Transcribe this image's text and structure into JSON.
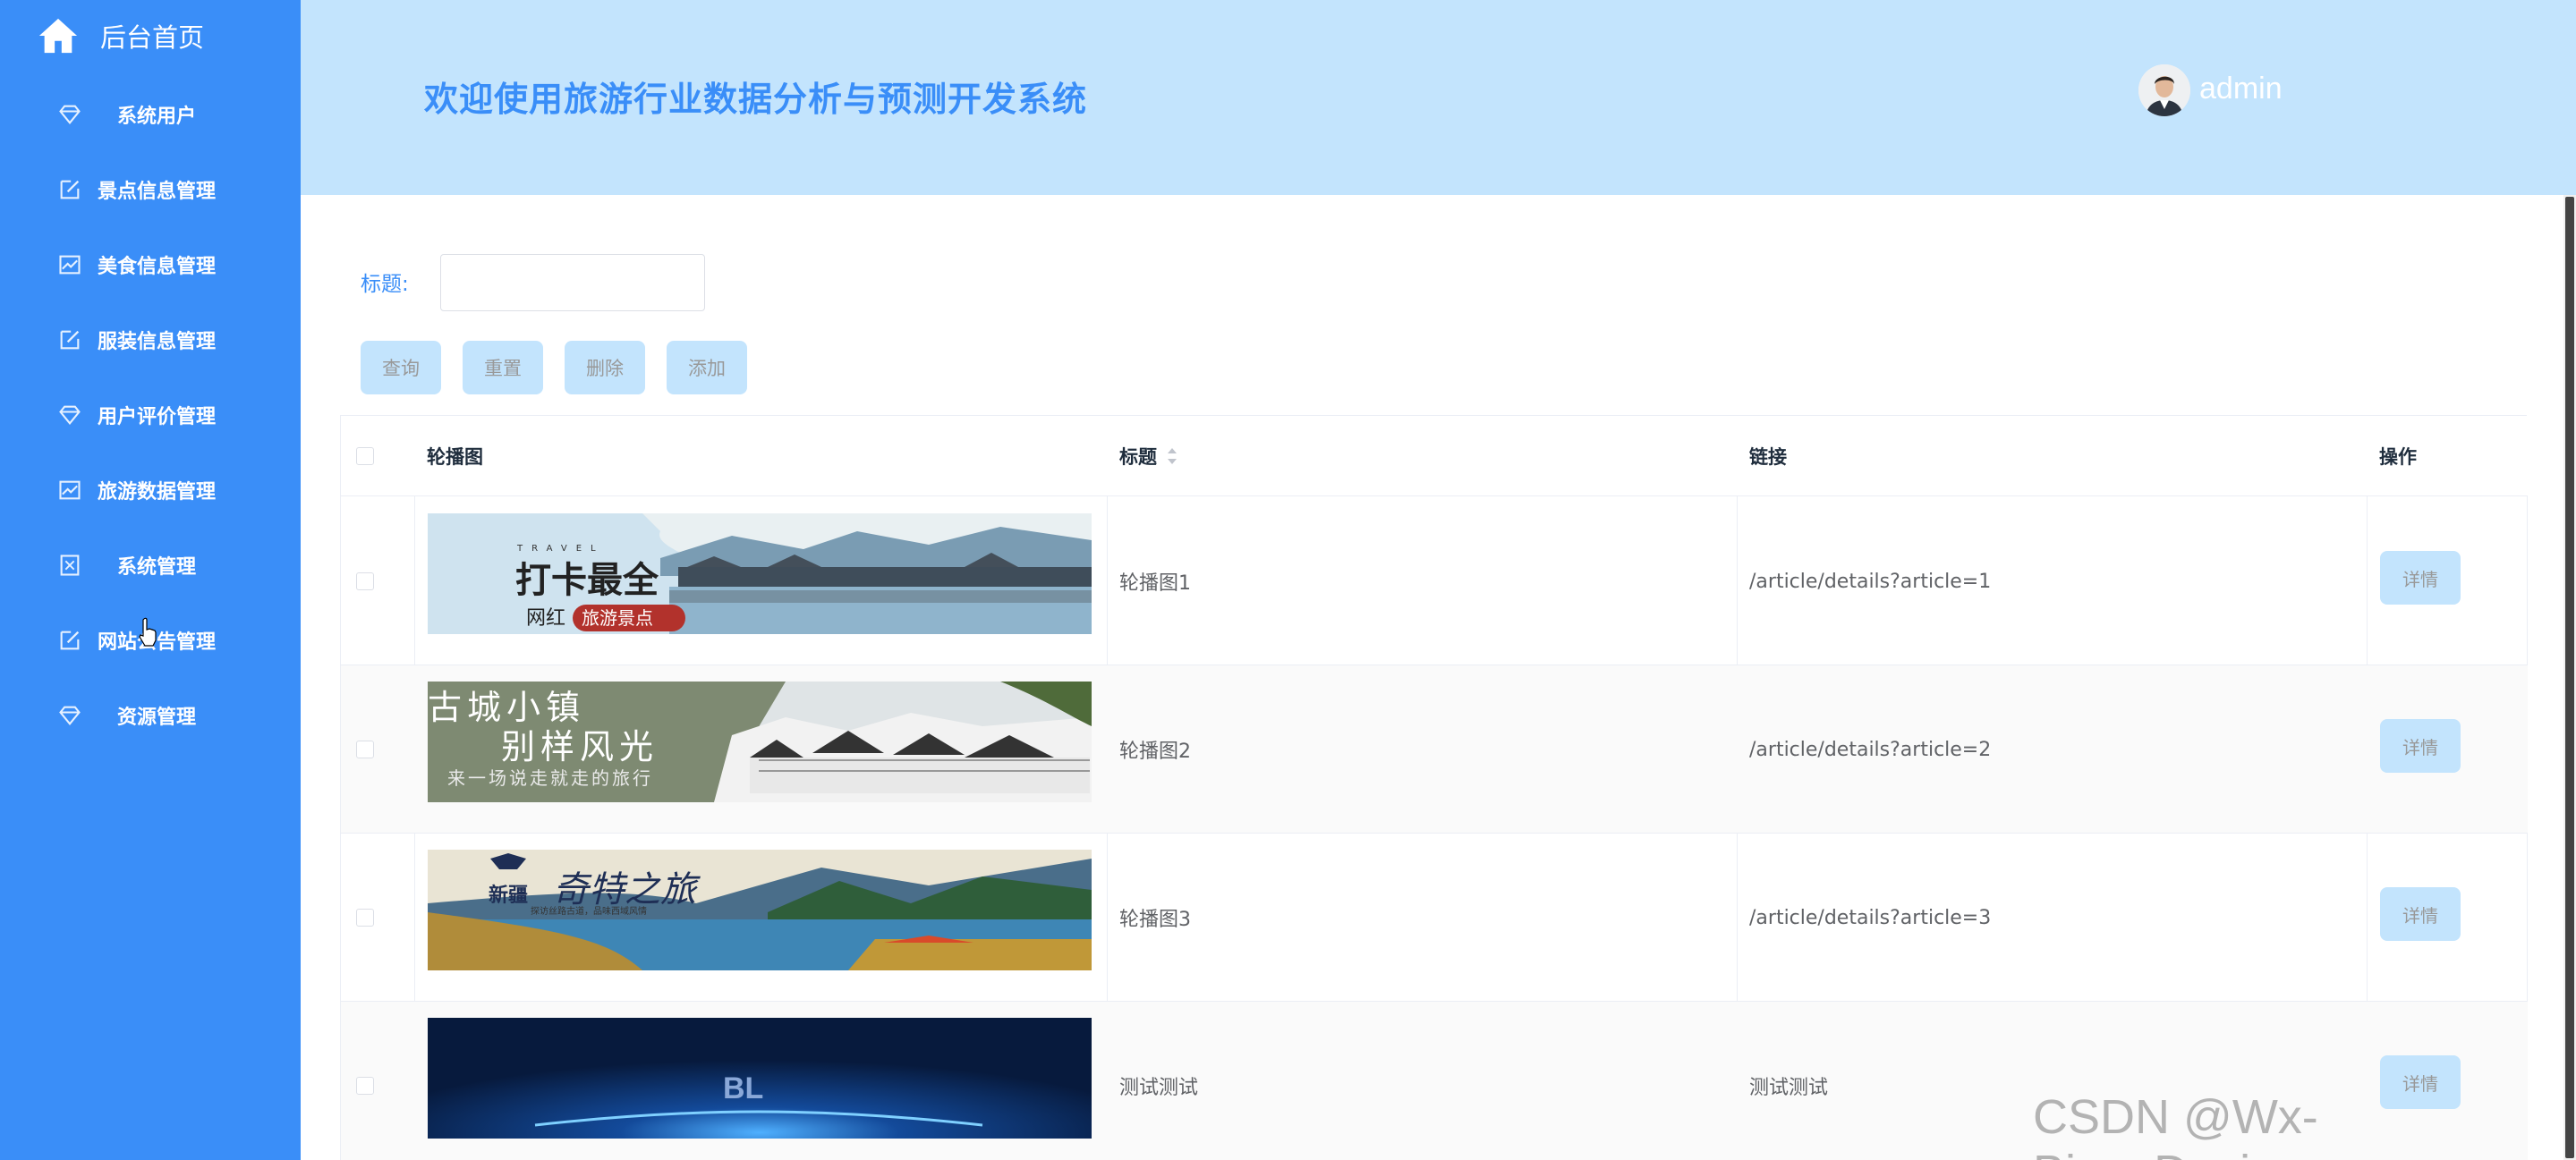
{
  "sidebar": {
    "home_label": "后台首页",
    "items": [
      {
        "label": "系统用户",
        "icon": "diamond-icon"
      },
      {
        "label": "景点信息管理",
        "icon": "edit-icon"
      },
      {
        "label": "美食信息管理",
        "icon": "chart-icon"
      },
      {
        "label": "服装信息管理",
        "icon": "edit-icon"
      },
      {
        "label": "用户评价管理",
        "icon": "diamond-icon"
      },
      {
        "label": "旅游数据管理",
        "icon": "chart-icon"
      },
      {
        "label": "系统管理",
        "icon": "document-icon"
      },
      {
        "label": "网站公告管理",
        "icon": "edit-icon"
      },
      {
        "label": "资源管理",
        "icon": "diamond-icon"
      }
    ]
  },
  "header": {
    "title": "欢迎使用旅游行业数据分析与预测开发系统",
    "username": "admin"
  },
  "search": {
    "label": "标题:",
    "value": "",
    "placeholder": ""
  },
  "toolbar": {
    "query": "查询",
    "reset": "重置",
    "delete": "删除",
    "add": "添加"
  },
  "table": {
    "headers": {
      "image": "轮播图",
      "title": "标题",
      "link": "链接",
      "actions": "操作"
    },
    "rows": [
      {
        "title": "轮播图1",
        "link": "/article/details?article=1",
        "action": "详情",
        "image_text_1": "打卡最全",
        "image_text_2": "网红",
        "image_text_3": "旅游景点",
        "image_text_4": "TRAVEL"
      },
      {
        "title": "轮播图2",
        "link": "/article/details?article=2",
        "action": "详情",
        "image_text_1": "古城小镇",
        "image_text_2": "别样风光",
        "image_text_3": "来一场说走就走的旅行"
      },
      {
        "title": "轮播图3",
        "link": "/article/details?article=3",
        "action": "详情",
        "image_text_1": "新疆",
        "image_text_2": "奇特之旅",
        "image_text_3": "探访丝路古道，品味西域风情"
      },
      {
        "title": "测试测试",
        "link": "测试测试",
        "action": "详情",
        "image_text_1": "BL"
      }
    ]
  },
  "watermark": "CSDN @Wx-Biye_Design",
  "colors": {
    "sidebar": "#3a8ef8",
    "header": "#c3e4fd",
    "accent": "#3a8ef8"
  }
}
